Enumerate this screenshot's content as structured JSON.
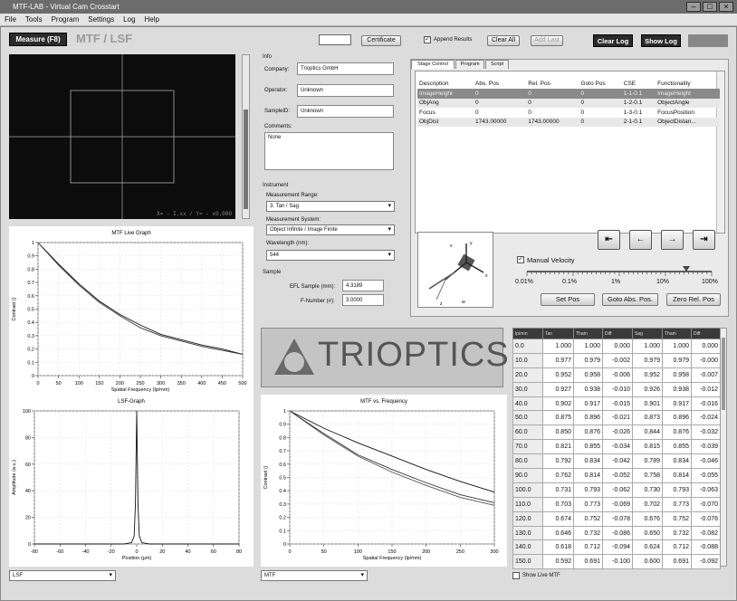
{
  "window": {
    "title": "MTF-LAB - Virtual Cam Crosstart"
  },
  "menu": [
    "File",
    "Tools",
    "Program",
    "Settings",
    "Log",
    "Help"
  ],
  "toolbar": {
    "measure_label": "Measure (F8)",
    "mode_title": "MTF / LSF",
    "certificate_label": "Certificate",
    "append_results_label": "Append Results",
    "clear_all_label": "Clear All",
    "add_last_label": "Add Last",
    "clear_log_label": "Clear Log",
    "show_log_label": "Show Log"
  },
  "camera": {
    "overlay": "X=  -  I.xx  /  Y= -  x0.000"
  },
  "info": {
    "section_label": "Info",
    "company_label": "Company:",
    "company_value": "Trioptics GmbH",
    "operator_label": "Operator:",
    "operator_value": "Unknown",
    "sample_id_label": "SampleID:",
    "sample_id_value": "Unknown",
    "comments_label": "Comments:",
    "comments_value": "None"
  },
  "instrument": {
    "section_label": "Instrument",
    "range_label": "Measurement Range:",
    "range_value": "3. Tan / Sag",
    "system_label": "Measurement System:",
    "system_value": "Object Infinite / Image Finite",
    "wavelength_label": "Wavelength (nm):",
    "wavelength_value": "544"
  },
  "sample": {
    "section_label": "Sample",
    "efl_label": "EFL Sample (mm):",
    "efl_value": "4.3189",
    "fnumber_label": "F-Number (#):",
    "fnumber_value": "3.0000"
  },
  "stage_tabs": [
    "Stage Control",
    "Program",
    "Script"
  ],
  "stage_table": {
    "headers": [
      "Description",
      "Abs. Pos",
      "Rel. Pos",
      "Goto Pos",
      "CSE",
      "Functionality"
    ],
    "rows": [
      [
        "ImageHeight",
        "0",
        "0",
        "0",
        "1-1-0.1",
        "ImageHeight"
      ],
      [
        "ObjAng",
        "0",
        "0",
        "0",
        "1-2-0.1",
        "ObjectAngle"
      ],
      [
        "Focus",
        "0",
        "0",
        "0",
        "1-3-0.1",
        "FocusPosition"
      ],
      [
        "ObjDist",
        "1743.00000",
        "1743.00000",
        "0",
        "2-1-0.1",
        "ObjectDistan..."
      ]
    ]
  },
  "stage_controls": {
    "manual_velocity_label": "Manual Velocity",
    "velocity_ticks": [
      "0.01%",
      "0.1%",
      "1%",
      "10%",
      "100%"
    ],
    "velocity_percent": 100,
    "set_pos_label": "Set Pos",
    "goto_abs_label": "Goto Abs. Pos.",
    "zero_rel_label": "Zero Rel. Pos",
    "arrows": [
      "⇤",
      "←",
      "→",
      "⇥"
    ]
  },
  "logo": {
    "text": "TRIOPTICS"
  },
  "mtf_live": {
    "title": "MTF Live Graph",
    "xlabel": "Spatial Frequency (lp/mm)",
    "ylabel": "Contrast ()",
    "xticks": [
      "0",
      "50",
      "100",
      "150",
      "200",
      "250",
      "300",
      "350",
      "400",
      "450",
      "500"
    ],
    "yticks": [
      "0",
      "0.1",
      "0.2",
      "0.3",
      "0.4",
      "0.5",
      "0.6",
      "0.7",
      "0.8",
      "0.9",
      "1"
    ]
  },
  "lsf_graph": {
    "title": "LSF-Graph",
    "xlabel": "Position (µm)",
    "ylabel": "Amplitude (a.u.)",
    "xticks": [
      "-80",
      "-60",
      "-40",
      "-20",
      "0",
      "20",
      "40",
      "60",
      "80"
    ],
    "yticks": [
      "0",
      "20",
      "40",
      "60",
      "80",
      "100"
    ]
  },
  "mtf_freq": {
    "title": "MTF vs. Frequency",
    "xlabel": "Spatial Frequency (lp/mm)",
    "ylabel": "Contrast ()",
    "xticks": [
      "0",
      "50",
      "100",
      "150",
      "200",
      "250",
      "300"
    ],
    "yticks": [
      "0",
      "0.1",
      "0.2",
      "0.3",
      "0.4",
      "0.5",
      "0.6",
      "0.7",
      "0.8",
      "0.9",
      "1"
    ]
  },
  "chart_data": [
    {
      "type": "line",
      "title": "MTF Live Graph",
      "xlabel": "Spatial Frequency (lp/mm)",
      "ylabel": "Contrast ()",
      "xlim": [
        0,
        500
      ],
      "ylim": [
        0,
        1
      ],
      "x": [
        0,
        50,
        100,
        150,
        200,
        250,
        300,
        350,
        400,
        450,
        500
      ],
      "series": [
        {
          "values": [
            1.0,
            0.84,
            0.69,
            0.56,
            0.46,
            0.38,
            0.31,
            0.27,
            0.23,
            0.2,
            0.16
          ]
        },
        {
          "values": [
            1.0,
            0.83,
            0.68,
            0.55,
            0.45,
            0.36,
            0.3,
            0.26,
            0.22,
            0.19,
            0.16
          ]
        }
      ]
    },
    {
      "type": "line",
      "title": "LSF-Graph",
      "xlabel": "Position (µm)",
      "ylabel": "Amplitude (a.u.)",
      "xlim": [
        -80,
        80
      ],
      "ylim": [
        0,
        100
      ],
      "x": [
        -80,
        -40,
        -10,
        -4,
        -2,
        -1,
        0,
        1,
        2,
        4,
        10,
        40,
        80
      ],
      "series": [
        {
          "values": [
            0,
            0,
            0,
            1,
            6,
            30,
            100,
            30,
            6,
            1,
            0,
            0,
            0
          ]
        }
      ]
    },
    {
      "type": "line",
      "title": "MTF vs. Frequency",
      "xlabel": "Spatial Frequency (lp/mm)",
      "ylabel": "Contrast ()",
      "xlim": [
        0,
        300
      ],
      "ylim": [
        0,
        1
      ],
      "x": [
        0,
        50,
        100,
        150,
        200,
        250,
        300
      ],
      "series": [
        {
          "values": [
            1.0,
            0.87,
            0.76,
            0.66,
            0.56,
            0.47,
            0.39
          ]
        },
        {
          "values": [
            1.0,
            0.83,
            0.67,
            0.56,
            0.46,
            0.37,
            0.31
          ]
        },
        {
          "values": [
            1.0,
            0.82,
            0.66,
            0.54,
            0.44,
            0.35,
            0.29
          ]
        }
      ]
    }
  ],
  "mtf_table": {
    "headers": [
      "lp/mm",
      "Tan",
      "Tham",
      "Diff",
      "Sag",
      "Tham",
      "Diff"
    ],
    "rows": [
      [
        "0.0",
        "1.000",
        "1.000",
        "0.000",
        "1.000",
        "1.000",
        "0.000"
      ],
      [
        "10.0",
        "0.977",
        "0.979",
        "-0.002",
        "0.979",
        "0.979",
        "-0.000"
      ],
      [
        "20.0",
        "0.952",
        "0.958",
        "-0.006",
        "0.952",
        "0.958",
        "-0.007"
      ],
      [
        "30.0",
        "0.927",
        "0.938",
        "-0.010",
        "0.926",
        "0.938",
        "-0.012"
      ],
      [
        "40.0",
        "0.902",
        "0.917",
        "-0.015",
        "0.901",
        "0.917",
        "-0.016"
      ],
      [
        "50.0",
        "0.875",
        "0.896",
        "-0.021",
        "0.873",
        "0.896",
        "-0.024"
      ],
      [
        "60.0",
        "0.850",
        "0.876",
        "-0.026",
        "0.844",
        "0.876",
        "-0.032"
      ],
      [
        "70.0",
        "0.821",
        "0.855",
        "-0.034",
        "0.815",
        "0.855",
        "-0.039"
      ],
      [
        "80.0",
        "0.792",
        "0.834",
        "-0.042",
        "0.789",
        "0.834",
        "-0.046"
      ],
      [
        "90.0",
        "0.762",
        "0.814",
        "-0.052",
        "0.758",
        "0.814",
        "-0.055"
      ],
      [
        "100.0",
        "0.731",
        "0.793",
        "-0.062",
        "0.730",
        "0.793",
        "-0.063"
      ],
      [
        "110.0",
        "0.703",
        "0.773",
        "-0.069",
        "0.702",
        "0.773",
        "-0.070"
      ],
      [
        "120.0",
        "0.674",
        "0.752",
        "-0.078",
        "0.676",
        "0.752",
        "-0.076"
      ],
      [
        "130.0",
        "0.646",
        "0.732",
        "-0.086",
        "0.650",
        "0.732",
        "-0.082"
      ],
      [
        "140.0",
        "0.618",
        "0.712",
        "-0.094",
        "0.624",
        "0.712",
        "-0.088"
      ],
      [
        "150.0",
        "0.592",
        "0.691",
        "-0.100",
        "0.600",
        "0.691",
        "-0.092"
      ]
    ]
  },
  "bottom": {
    "lsf_select": "LSF",
    "mtf_select": "MTF",
    "show_live_label": "Show Live MTF"
  }
}
